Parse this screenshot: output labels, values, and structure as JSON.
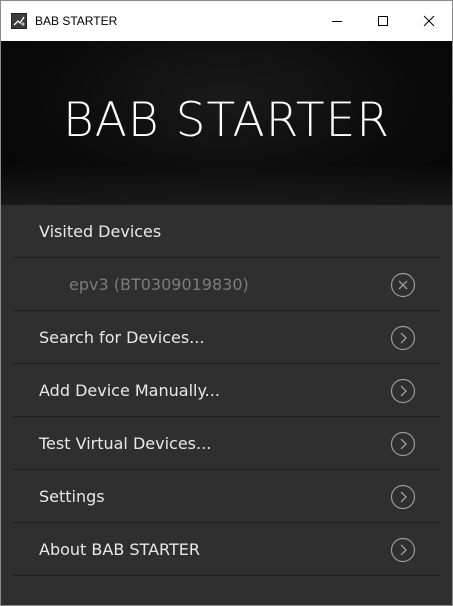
{
  "window": {
    "title": "BAB STARTER",
    "controls": [
      "minimize-icon",
      "maximize-icon",
      "close-icon"
    ]
  },
  "banner": {
    "title": "BAB STARTER"
  },
  "menu": {
    "section_label": "Visited Devices",
    "visited_device": {
      "label": "epv3 (BT0309019830)",
      "action_icon": "close-circle-icon"
    },
    "items": [
      {
        "label": "Search for Devices...",
        "icon": "chevron-right-circle-icon"
      },
      {
        "label": "Add Device Manually...",
        "icon": "chevron-right-circle-icon"
      },
      {
        "label": "Test Virtual Devices...",
        "icon": "chevron-right-circle-icon"
      },
      {
        "label": "Settings",
        "icon": "chevron-right-circle-icon"
      },
      {
        "label": "About BAB STARTER",
        "icon": "chevron-right-circle-icon"
      }
    ]
  },
  "colors": {
    "background": "#2f2f2f",
    "banner": "#0b0b0b",
    "text": "#e8e8e8",
    "muted_text": "#7c7c7c",
    "divider": "#1f1f1f"
  }
}
